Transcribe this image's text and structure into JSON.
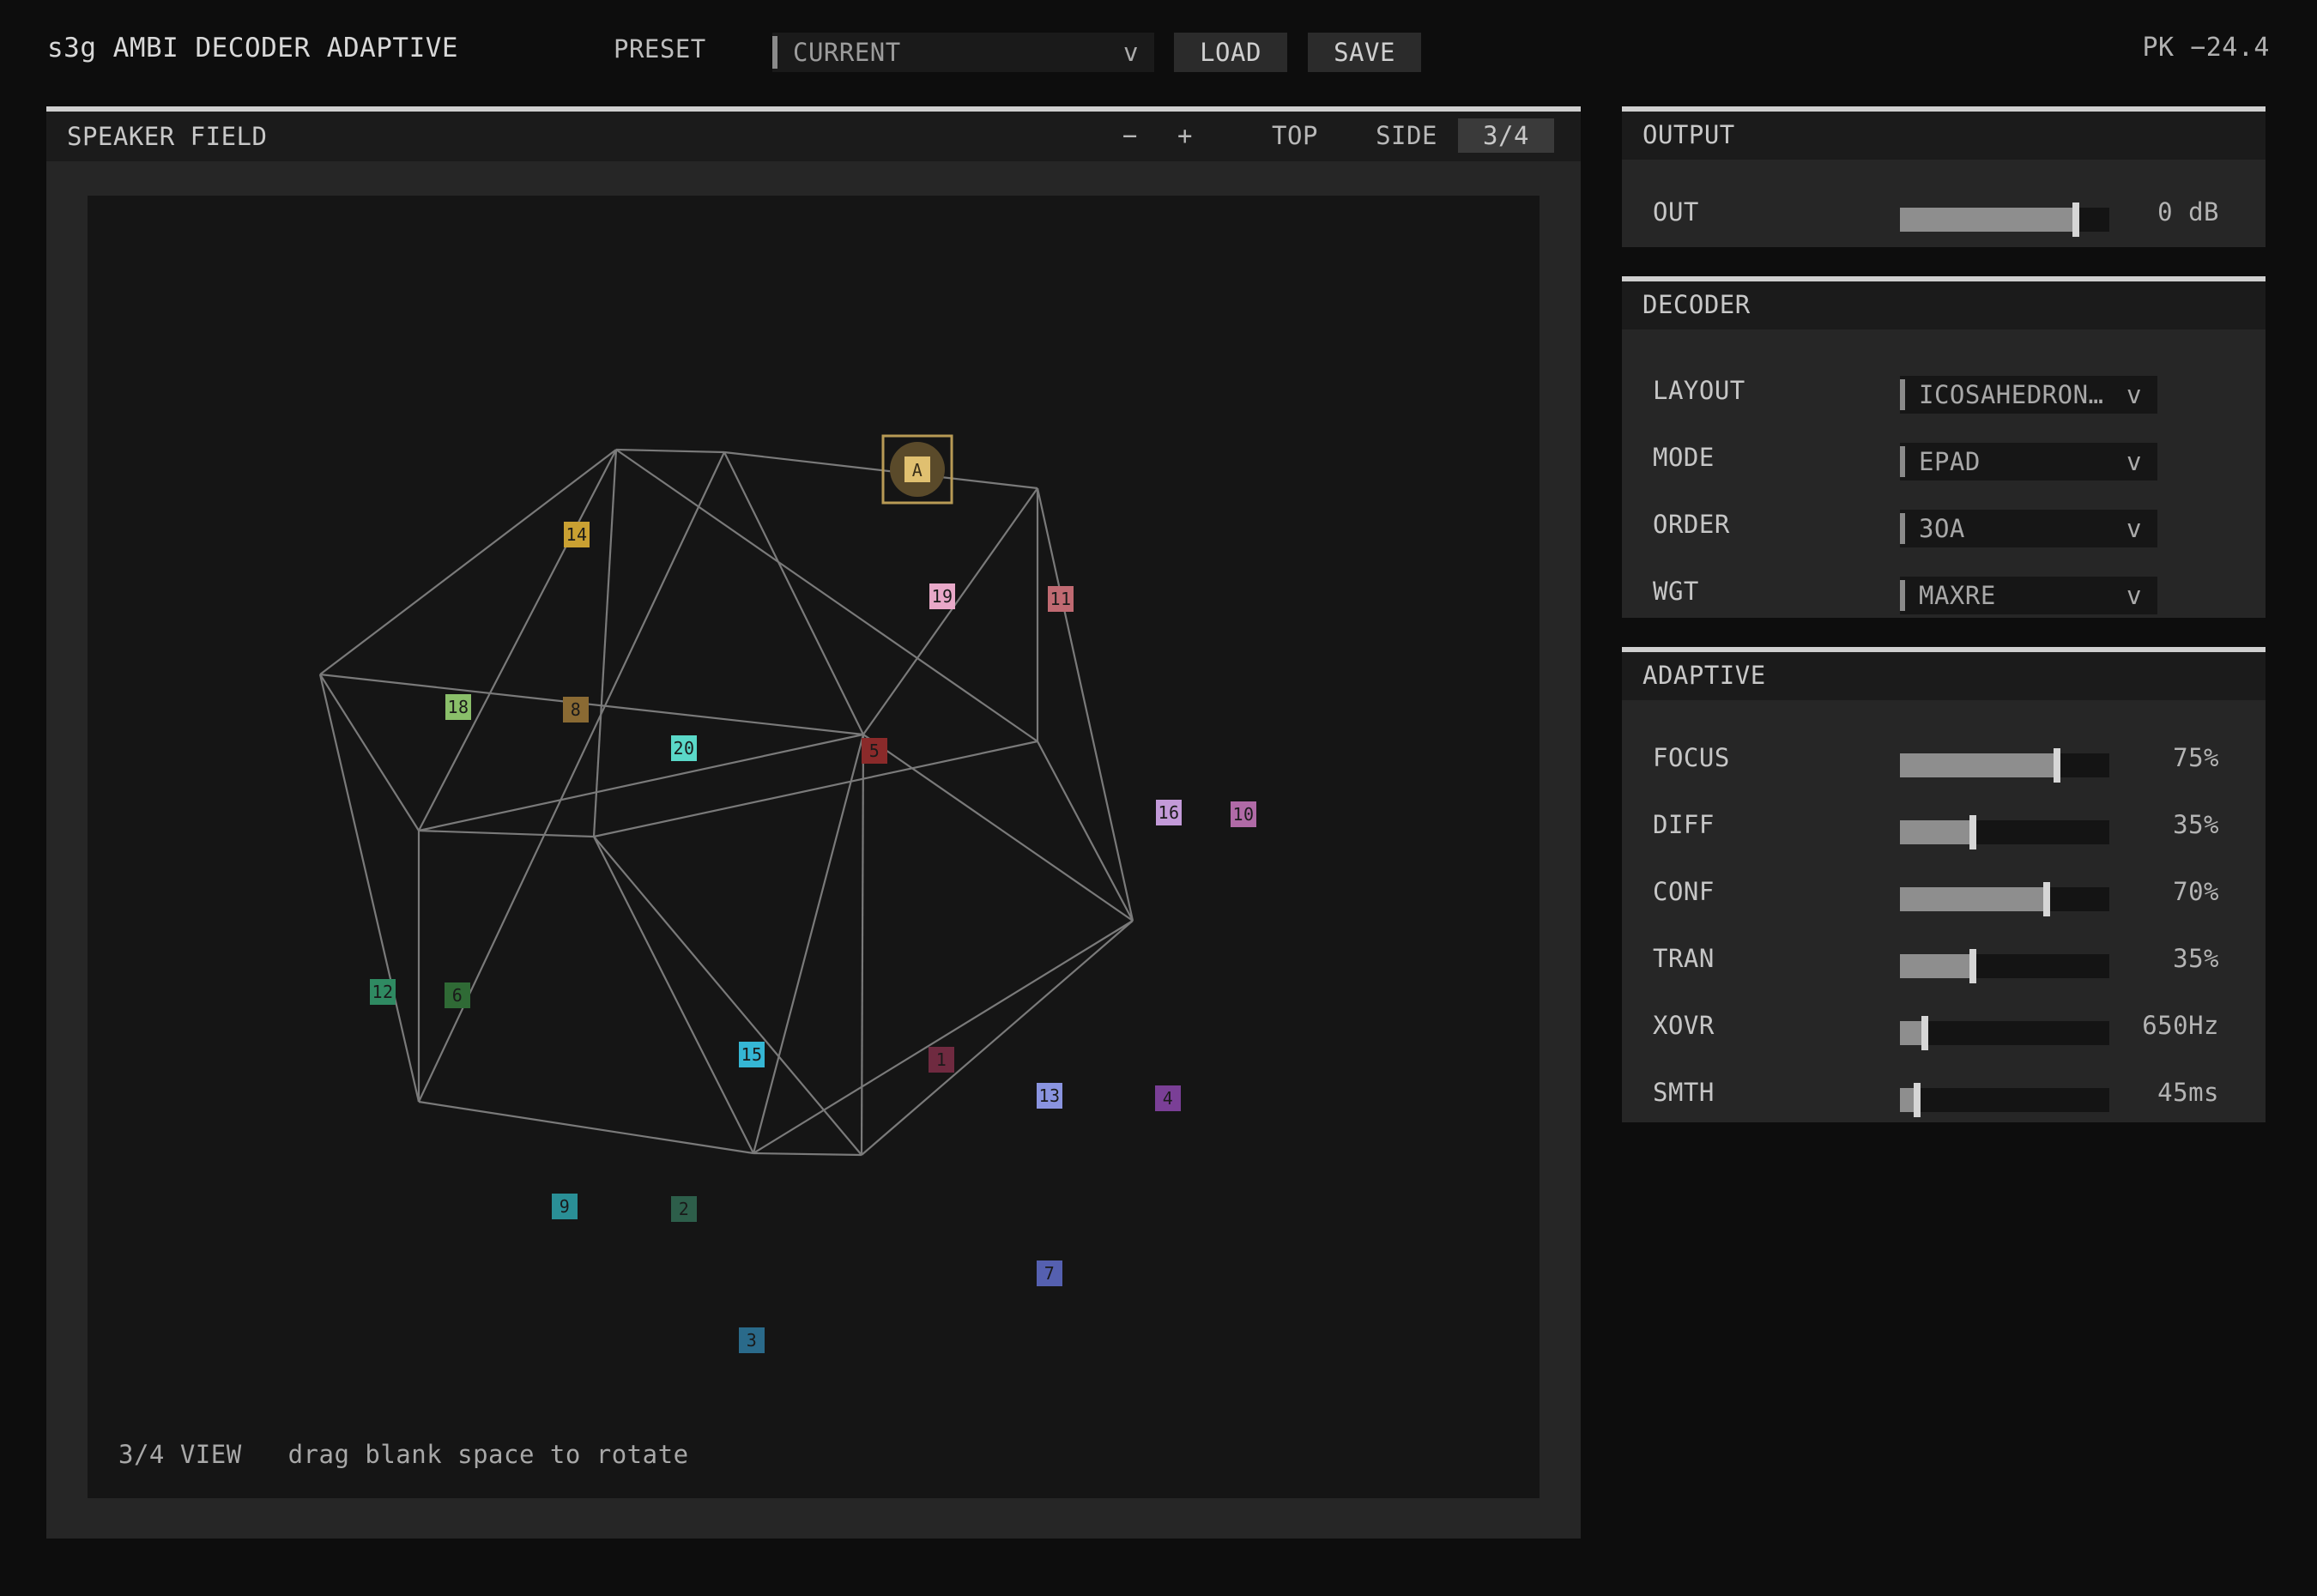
{
  "app": {
    "title": "s3g AMBI DECODER ADAPTIVE",
    "peak": "PK −24.4"
  },
  "preset": {
    "label": "PRESET",
    "value": "CURRENT",
    "chevron": "v",
    "load": "LOAD",
    "save": "SAVE"
  },
  "field": {
    "title": "SPEAKER FIELD",
    "zoom_out": "−",
    "zoom_in": "+",
    "views": [
      "TOP",
      "SIDE",
      "3/4"
    ],
    "active_view": "3/4",
    "hint_mode": "3/4 VIEW",
    "hint_text": "drag blank space to rotate",
    "listener_label": "A",
    "speakers": [
      {
        "id": "1",
        "color": "#6f2a40"
      },
      {
        "id": "2",
        "color": "#2d5e4a"
      },
      {
        "id": "3",
        "color": "#2a6a8a"
      },
      {
        "id": "4",
        "color": "#7a3f96"
      },
      {
        "id": "5",
        "color": "#8a2a2a"
      },
      {
        "id": "6",
        "color": "#2f6a35"
      },
      {
        "id": "7",
        "color": "#5560b0"
      },
      {
        "id": "8",
        "color": "#8a6a33"
      },
      {
        "id": "9",
        "color": "#2a8f96"
      },
      {
        "id": "10",
        "color": "#b06aa6"
      },
      {
        "id": "11",
        "color": "#c06a72"
      },
      {
        "id": "12",
        "color": "#2f8a62"
      },
      {
        "id": "13",
        "color": "#8a94e0"
      },
      {
        "id": "14",
        "color": "#c9a032"
      },
      {
        "id": "15",
        "color": "#35b6d4"
      },
      {
        "id": "16",
        "color": "#c39ad8"
      },
      {
        "id": "18",
        "color": "#8abf6a"
      },
      {
        "id": "19",
        "color": "#e8a8c8"
      },
      {
        "id": "20",
        "color": "#5ad8c8"
      }
    ]
  },
  "output": {
    "title": "OUTPUT",
    "out_label": "OUT",
    "out_value": "0 dB",
    "out_level": 0.84
  },
  "decoder": {
    "title": "DECODER",
    "layout_label": "LAYOUT",
    "layout_value": "ICOSAHEDRON…",
    "mode_label": "MODE",
    "mode_value": "EPAD",
    "order_label": "ORDER",
    "order_value": "3OA",
    "wgt_label": "WGT",
    "wgt_value": "MAXRE",
    "chevron": "v"
  },
  "adaptive": {
    "title": "ADAPTIVE",
    "params": [
      {
        "label": "FOCUS",
        "value": "75%",
        "level": 0.75
      },
      {
        "label": "DIFF",
        "value": "35%",
        "level": 0.35
      },
      {
        "label": "CONF",
        "value": "70%",
        "level": 0.7
      },
      {
        "label": "TRAN",
        "value": "35%",
        "level": 0.35
      },
      {
        "label": "XOVR",
        "value": "650Hz",
        "level": 0.12
      },
      {
        "label": "SMTH",
        "value": "45ms",
        "level": 0.08
      }
    ]
  }
}
